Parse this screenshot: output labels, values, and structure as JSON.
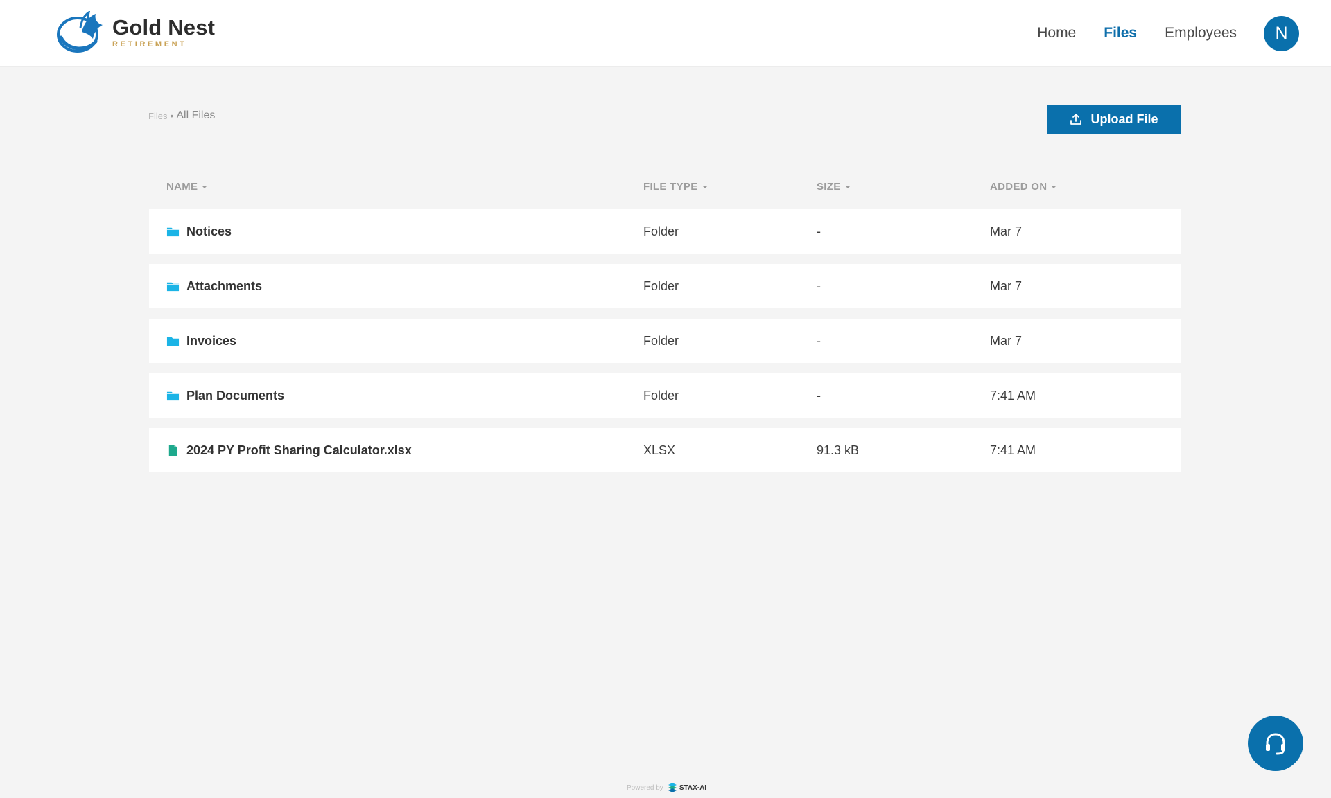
{
  "brand": {
    "title": "Gold Nest",
    "subtitle": "RETIREMENT"
  },
  "nav": {
    "items": [
      {
        "label": "Home"
      },
      {
        "label": "Files"
      },
      {
        "label": "Employees"
      }
    ],
    "active": "Files"
  },
  "user": {
    "initial": "N"
  },
  "breadcrumb": {
    "root": "Files",
    "separator": "•",
    "current": "All Files"
  },
  "actions": {
    "upload_label": "Upload File"
  },
  "table": {
    "columns": {
      "name": "NAME",
      "file_type": "FILE TYPE",
      "size": "SIZE",
      "added_on": "ADDED ON"
    },
    "rows": [
      {
        "name": "Notices",
        "icon": "folder-icon",
        "file_type": "Folder",
        "size": "-",
        "added_on": "Mar 7"
      },
      {
        "name": "Attachments",
        "icon": "folder-icon",
        "file_type": "Folder",
        "size": "-",
        "added_on": "Mar 7"
      },
      {
        "name": "Invoices",
        "icon": "folder-icon",
        "file_type": "Folder",
        "size": "-",
        "added_on": "Mar 7"
      },
      {
        "name": "Plan Documents",
        "icon": "folder-icon",
        "file_type": "Folder",
        "size": "-",
        "added_on": "7:41 AM"
      },
      {
        "name": "2024 PY Profit Sharing Calculator.xlsx",
        "icon": "file-icon",
        "file_type": "XLSX",
        "size": "91.3 kB",
        "added_on": "7:41 AM"
      }
    ]
  },
  "footer": {
    "powered_by": "Powered by",
    "vendor": "STAX·AI"
  },
  "colors": {
    "primary": "#0a70ac",
    "folder": "#1bb4e6",
    "file": "#1ea98d",
    "accent_gold": "#c9a255",
    "background": "#f4f4f4"
  }
}
